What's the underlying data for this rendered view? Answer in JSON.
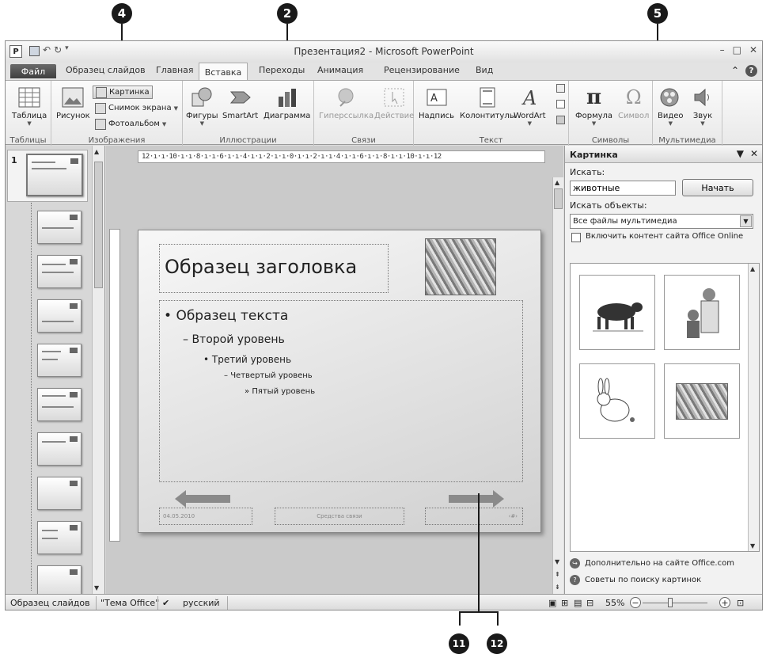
{
  "callouts": {
    "c4": "4",
    "c2": "2",
    "c5": "5",
    "c11": "11",
    "c12": "12"
  },
  "window": {
    "title": "Презентация2 - Microsoft PowerPoint",
    "app_icon": "P"
  },
  "quick_access": {
    "save": "save-icon",
    "undo": "↶",
    "redo": "↻"
  },
  "window_controls": {
    "minimize": "–",
    "maximize": "□",
    "close": "✕"
  },
  "tabs": [
    {
      "label": "Файл"
    },
    {
      "label": "Образец слайдов"
    },
    {
      "label": "Главная"
    },
    {
      "label": "Вставка"
    },
    {
      "label": "Переходы"
    },
    {
      "label": "Анимация"
    },
    {
      "label": "Рецензирование"
    },
    {
      "label": "Вид"
    }
  ],
  "ribbon": {
    "groups": {
      "tables": "Таблицы",
      "images": "Изображения",
      "illustrations": "Иллюстрации",
      "links": "Связи",
      "text": "Текст",
      "symbols": "Символы",
      "media": "Мультимедиа"
    },
    "buttons": {
      "table": "Таблица",
      "picture": "Рисунок",
      "clipart": "Картинка",
      "screenshot": "Снимок экрана",
      "album": "Фотоальбом",
      "shapes": "Фигуры",
      "smartart": "SmartArt",
      "chart": "Диаграмма",
      "hyperlink": "Гиперссылка",
      "action": "Действие",
      "textbox": "Надпись",
      "header": "Колонтитулы",
      "wordart": "WordArt",
      "equation": "Формула",
      "symbol": "Символ",
      "video": "Видео",
      "audio": "Звук"
    }
  },
  "thumbnails": {
    "first_number": "1"
  },
  "ruler": {
    "horizontal": "12·ı·ı·10·ı·ı·8·ı·ı·6·ı·ı·4·ı·ı·2·ı·ı·0·ı·ı·2·ı·ı·4·ı·ı·6·ı·ı·8·ı·ı·10·ı·ı·12"
  },
  "slide": {
    "title": "Образец заголовка",
    "levels": [
      "Образец текста",
      "Второй уровень",
      "Третий уровень",
      "Четвертый уровень",
      "Пятый уровень"
    ],
    "bullets": [
      "•",
      "–",
      "•",
      "–",
      "»"
    ],
    "footer_date": "04.05.2010",
    "footer_center": "Средства связи",
    "footer_num": "‹#›"
  },
  "task_pane": {
    "title": "Картинка",
    "search_label": "Искать:",
    "search_value": "животные",
    "search_button": "Начать",
    "objects_label": "Искать объекты:",
    "objects_value": "Все файлы мультимедиа",
    "online_label": "Включить контент сайта Office Online",
    "online_checked": false,
    "clips": [
      "cow-clip",
      "doctor-child-clip",
      "rabbit-clip",
      "tiger-photo-clip"
    ],
    "link_more": "Дополнительно на сайте Office.com",
    "link_tips": "Советы по поиску картинок"
  },
  "status": {
    "view": "Образец слайдов",
    "theme": "\"Тема Office\"",
    "language": "русский",
    "zoom": "55%",
    "zoom_level": 0.55
  }
}
